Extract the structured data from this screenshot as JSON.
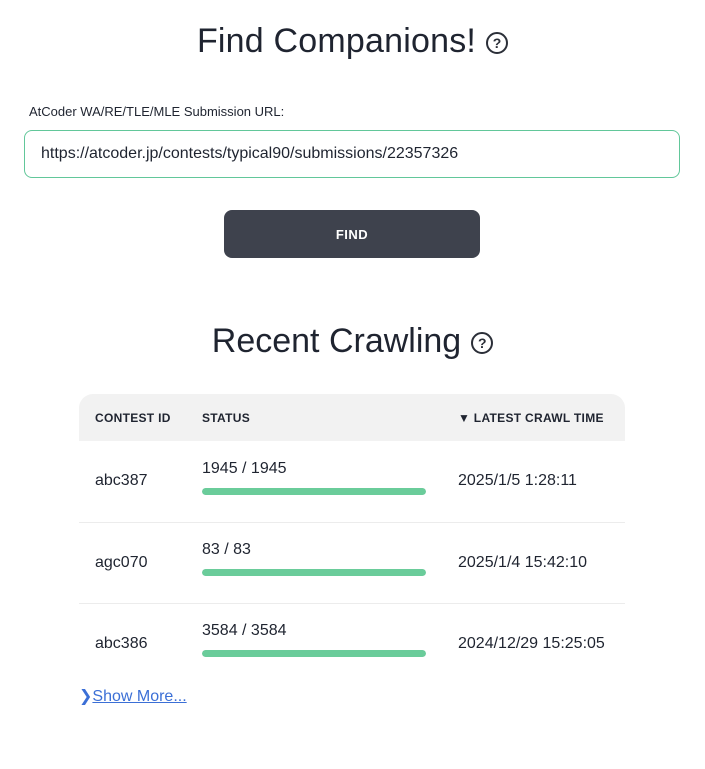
{
  "header": {
    "title": "Find Companions!",
    "help_icon": "?"
  },
  "form": {
    "label": "AtCoder WA/RE/TLE/MLE Submission URL:",
    "url_value": "https://atcoder.jp/contests/typical90/submissions/22357326",
    "find_label": "FIND"
  },
  "recent": {
    "title": "Recent Crawling",
    "help_icon": "?",
    "columns": {
      "contest": "CONTEST ID",
      "status": "STATUS",
      "time": "▼ LATEST CRAWL TIME"
    },
    "rows": [
      {
        "contest_id": "abc387",
        "status": "1945 / 1945",
        "progress": 1.0,
        "time": "2025/1/5 1:28:11"
      },
      {
        "contest_id": "agc070",
        "status": "83 / 83",
        "progress": 1.0,
        "time": "2025/1/4 15:42:10"
      },
      {
        "contest_id": "abc386",
        "status": "3584 / 3584",
        "progress": 1.0,
        "time": "2024/12/29 15:25:05"
      }
    ],
    "show_more_icon": "❯",
    "show_more_label": "Show More..."
  },
  "colors": {
    "accent_green": "#6acc9a",
    "button_dark": "#3e424d",
    "link_blue": "#3b6fd6"
  }
}
